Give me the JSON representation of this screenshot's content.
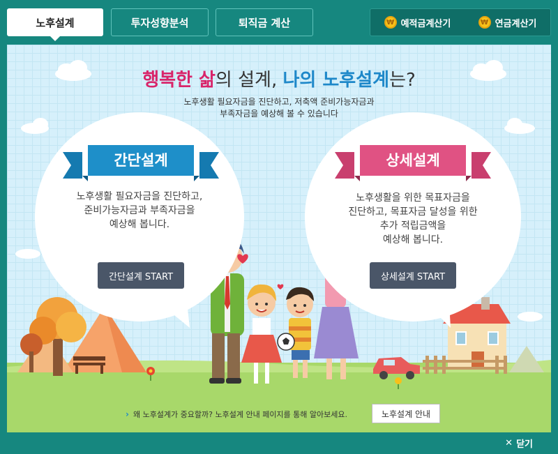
{
  "tabs": [
    {
      "label": "노후설계",
      "active": true
    },
    {
      "label": "투자성향분석",
      "active": false
    },
    {
      "label": "퇴직금 계산",
      "active": false
    }
  ],
  "calculators": [
    {
      "label": "예적금계산기",
      "icon": "won-coin-icon"
    },
    {
      "label": "연금계산기",
      "icon": "won-coin-icon"
    }
  ],
  "coin_symbol": "₩",
  "headline": {
    "part1": "행복한 삶",
    "part2": "의 설계, ",
    "part3": "나의 노후설계",
    "part4": "는?"
  },
  "subtitle": {
    "line1": "노후생활 필요자금을 진단하고, 저축액 준비가능자금과",
    "line2": "부족자금을 예상해 볼 수 있습니다"
  },
  "simple": {
    "title": "간단설계",
    "desc_lines": [
      "노후생활 필요자금을 진단하고,",
      "준비가능자금과 부족자금을",
      "예상해 봅니다."
    ],
    "button": "간단설계 START",
    "color": "#1e8fc9"
  },
  "detail": {
    "title": "상세설계",
    "desc_lines": [
      "노후생활을 위한 목표자금을",
      "진단하고, 목표자금 달성을 위한",
      "추가 적립금액을",
      "예상해 봅니다."
    ],
    "button": "상세설계 START",
    "color": "#e05283"
  },
  "bottom": {
    "note": "왜 노후설계가 중요할까? 노후설계 안내 페이지를 통해 알아보세요.",
    "guide_button": "노후설계 안내"
  },
  "close_label": "닫기",
  "colors": {
    "frame": "#16877f",
    "panel_bg": "#d6f0fb",
    "pink": "#d8246a",
    "blue": "#1e88c9",
    "button": "#4a5668"
  }
}
